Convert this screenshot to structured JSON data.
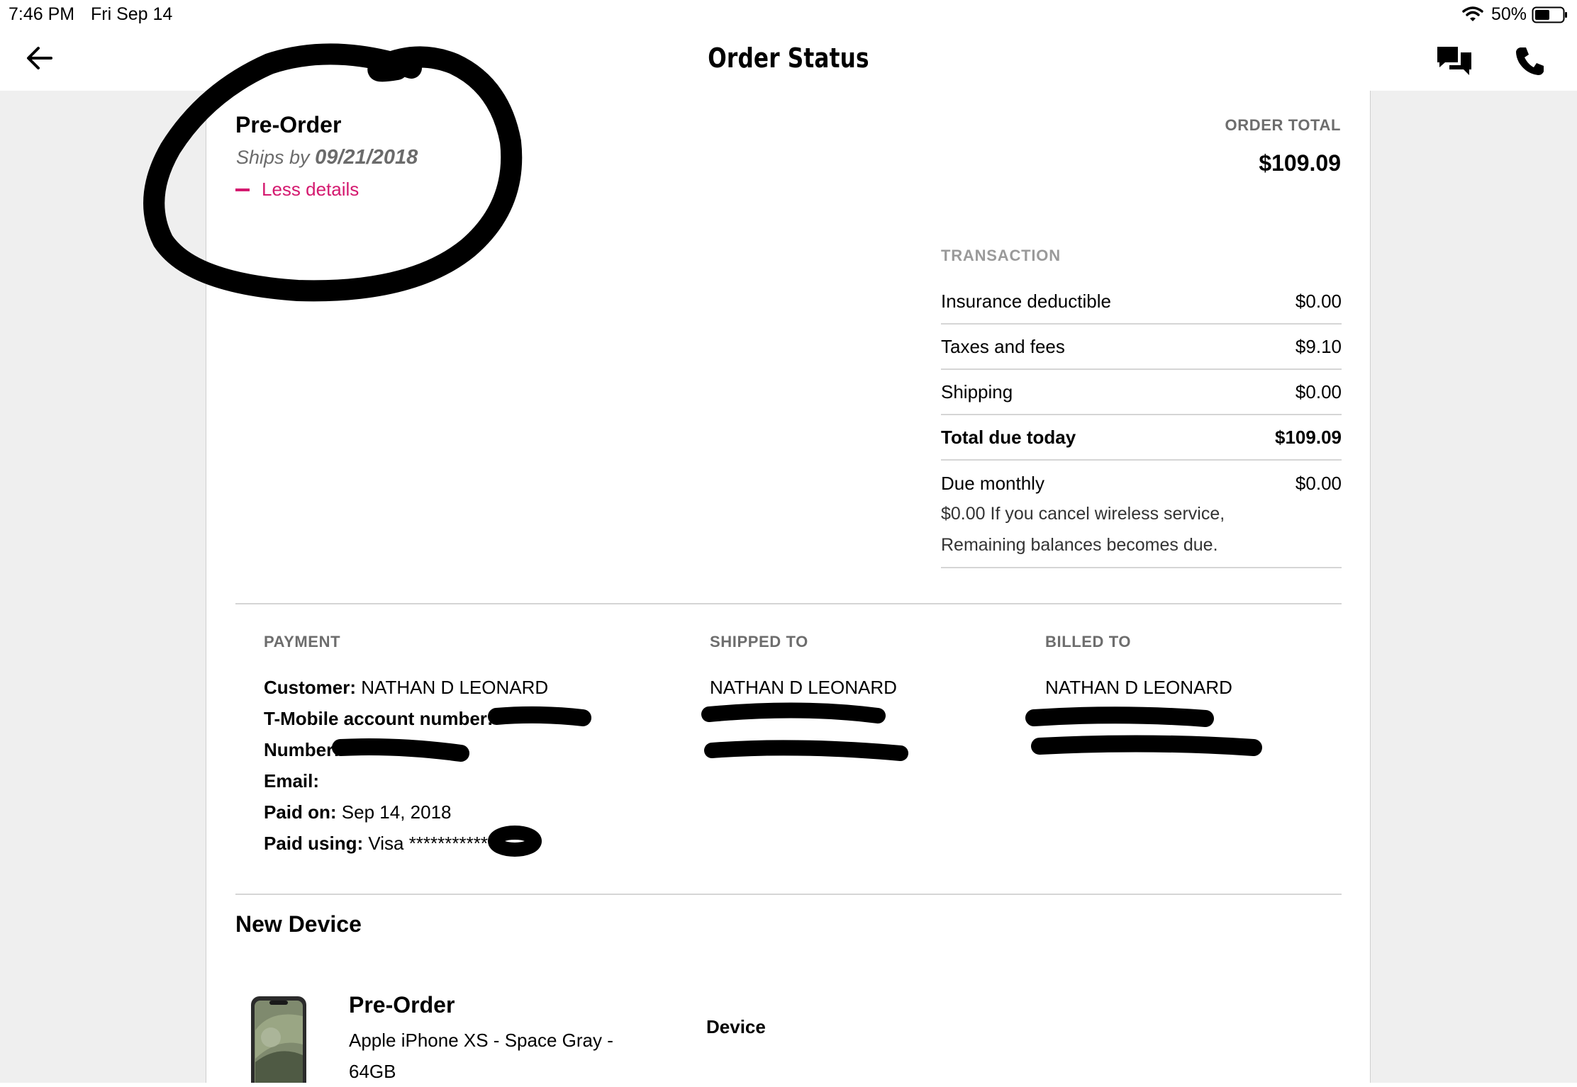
{
  "status_bar": {
    "time": "7:46 PM",
    "date": "Fri Sep 14",
    "battery": "50%"
  },
  "header": {
    "title": "Order Status"
  },
  "order": {
    "status": "Pre-Order",
    "ships_prefix": "Ships by",
    "ships_date": "09/21/2018",
    "toggle_label": "Less details",
    "total_label": "ORDER TOTAL",
    "total_value": "$109.09"
  },
  "transaction": {
    "label": "TRANSACTION",
    "rows": [
      {
        "label": "Insurance deductible",
        "value": "$0.00"
      },
      {
        "label": "Taxes and fees",
        "value": "$9.10"
      },
      {
        "label": "Shipping",
        "value": "$0.00"
      },
      {
        "label": "Total due today",
        "value": "$109.09"
      },
      {
        "label": "Due monthly",
        "value": "$0.00"
      }
    ],
    "monthly_note_1": "$0.00 If you cancel wireless service,",
    "monthly_note_2": "Remaining balances becomes due."
  },
  "payment": {
    "label": "PAYMENT",
    "customer_label": "Customer:",
    "customer_value": "NATHAN D LEONARD",
    "account_label": "T-Mobile account number:",
    "number_label": "Number:",
    "email_label": "Email:",
    "paid_on_label": "Paid on:",
    "paid_on_value": "Sep 14, 2018",
    "paid_using_label": "Paid using:",
    "paid_using_value": "Visa ************"
  },
  "shipped_to": {
    "label": "SHIPPED TO",
    "name": "NATHAN D LEONARD"
  },
  "billed_to": {
    "label": "BILLED TO",
    "name": "NATHAN D LEONARD"
  },
  "new_device": {
    "heading": "New Device",
    "status": "Pre-Order",
    "name_line1": "Apple iPhone XS - Space Gray -",
    "name_line2": "64GB",
    "column_label": "Device"
  },
  "icons": [
    "wifi-icon",
    "battery-icon",
    "back-arrow-icon",
    "chat-icon",
    "phone-icon"
  ],
  "colors": {
    "accent": "#d4196f",
    "page_gray": "#efefef"
  }
}
